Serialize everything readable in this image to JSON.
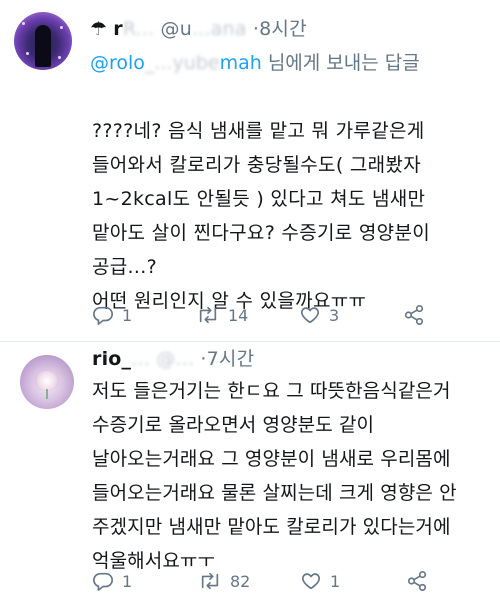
{
  "tweets": [
    {
      "avatar": "avatar-dark-purple-figure",
      "name_prefix": "☂",
      "name_visible": "r",
      "name_blur": "R...",
      "handle_prefix": "@u",
      "handle_blur": "...ana",
      "separator": "·",
      "time": "8시간",
      "reply_to_handle_start": "@rolo",
      "reply_to_handle_blur": "_...yube",
      "reply_to_handle_end": "mah",
      "reply_to_suffix": "님에게 보내는 답글",
      "text": "????네? 음식 냄새를 맡고 뭐 가루같은게\n들어와서 칼로리가 충당될수도( 그래봤자\n1~2kcal도 안될듯 ) 있다고 쳐도 냄새만\n맡아도 살이 찐다구요? 수증기로 영양분이\n공급...?\n어떤 원리인지 알 수 있을까요ㅠㅠ",
      "actions": {
        "reply": "1",
        "retweet": "14",
        "like": "3"
      }
    },
    {
      "avatar": "avatar-lilac-flower",
      "name_visible": "rio_",
      "name_blur": "...",
      "handle_blur": "@...",
      "separator": "·",
      "time": "7시간",
      "text": "저도 들은거기는 한ㄷ요 그 따뜻한음식같은거\n수증기로 올라오면서 영양분도 같이\n날아오는거래요 그 영양분이 냄새로 우리몸에\n들어오는거래요 물론 살찌는데 크게 영향은 안\n주겠지만 냄새만 맡아도 칼로리가 있다는거에\n억울해서요ㅠㅜ",
      "actions": {
        "reply": "1",
        "retweet": "82",
        "like": "1"
      }
    }
  ],
  "colors": {
    "text": "#14171a",
    "muted": "#657786",
    "link": "#1da1f2",
    "divider": "#e6ecf0"
  }
}
